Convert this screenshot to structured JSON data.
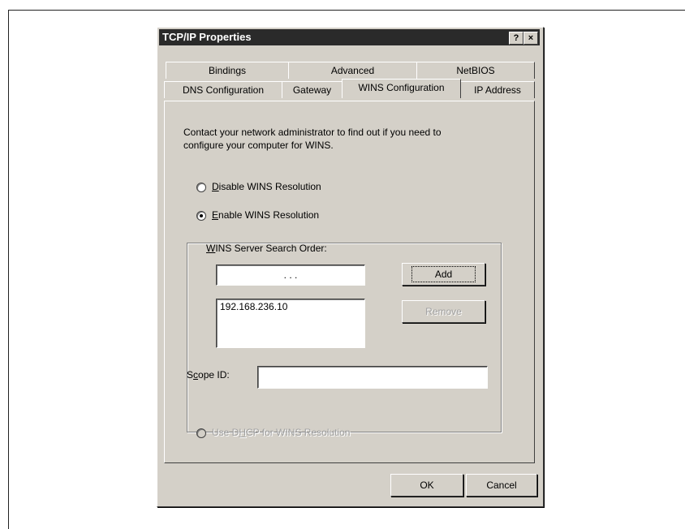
{
  "dialog": {
    "title": "TCP/IP Properties",
    "help_label": "?",
    "close_label": "×"
  },
  "tabs_back": [
    "Bindings",
    "Advanced",
    "NetBIOS"
  ],
  "tabs_front": [
    "DNS Configuration",
    "Gateway",
    "WINS Configuration",
    "IP Address"
  ],
  "active_tab": "WINS Configuration",
  "panel": {
    "instruction_line1": "Contact your network administrator to find out if you need to",
    "instruction_line2": "configure your computer for WINS.",
    "disable_wins": {
      "label_accel": "D",
      "label_rest": "isable WINS Resolution",
      "checked": false
    },
    "enable_wins": {
      "label_accel": "E",
      "label_rest": "nable WINS Resolution",
      "checked": true
    },
    "search_order_accel": "W",
    "search_order_rest": "INS Server Search Order:",
    "ip_input_value": ".    .    .",
    "server_list": [
      "192.168.236.10"
    ],
    "add_button": "Add",
    "remove_button": "Remove",
    "scope_id_prefix": "S",
    "scope_id_accel": "c",
    "scope_id_rest": "ope ID:",
    "scope_id_value": "",
    "dhcp_wins": {
      "label_pre": "Use D",
      "label_accel": "H",
      "label_rest": "CP for WINS Resolution",
      "checked": false
    }
  },
  "footer": {
    "ok": "OK",
    "cancel": "Cancel"
  }
}
